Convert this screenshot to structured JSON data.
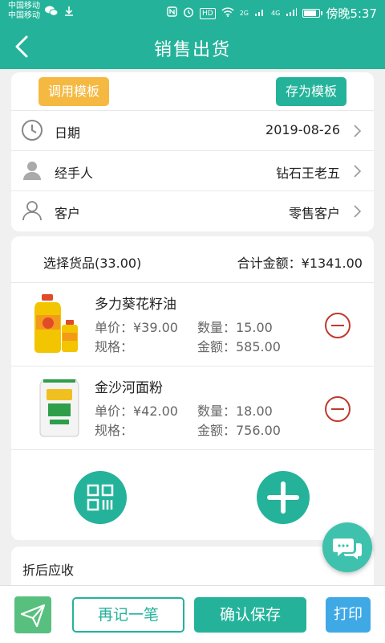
{
  "status_bar": {
    "carrier1": "中国移动",
    "carrier2": "中国移动",
    "hd": "HD",
    "net1": "2G",
    "net2": "4G",
    "time": "傍晚5:37",
    "battery_level": 0.85
  },
  "header": {
    "title": "销售出货"
  },
  "template": {
    "load_label": "调用模板",
    "save_label": "存为模板"
  },
  "info": {
    "date_label": "日期",
    "date_value": "2019-08-26",
    "handler_label": "经手人",
    "handler_value": "钻石王老五",
    "customer_label": "客户",
    "customer_value": "零售客户"
  },
  "goods_section": {
    "title": "选择货品(33.00)",
    "total": "合计金额：¥1341.00"
  },
  "goods": [
    {
      "name": "多力葵花籽油",
      "price": "单价：¥39.00",
      "qty": "数量：15.00",
      "spec": "规格：",
      "amount": "金额：585.00",
      "image": "sunflower-oil-bottle"
    },
    {
      "name": "金沙河面粉",
      "price": "单价：¥42.00",
      "qty": "数量：18.00",
      "spec": "规格：",
      "amount": "金额：756.00",
      "image": "flour-bag"
    }
  ],
  "discount": {
    "label": "折后应收",
    "value": ""
  },
  "bottom": {
    "again_label": "再记一笔",
    "confirm_label": "确认保存",
    "print_label": "打印"
  },
  "colors": {
    "primary": "#24b39a",
    "template_btn": "#f5b942",
    "delete": "#c0392b",
    "print": "#3fa9e6",
    "send": "#58c07e"
  }
}
